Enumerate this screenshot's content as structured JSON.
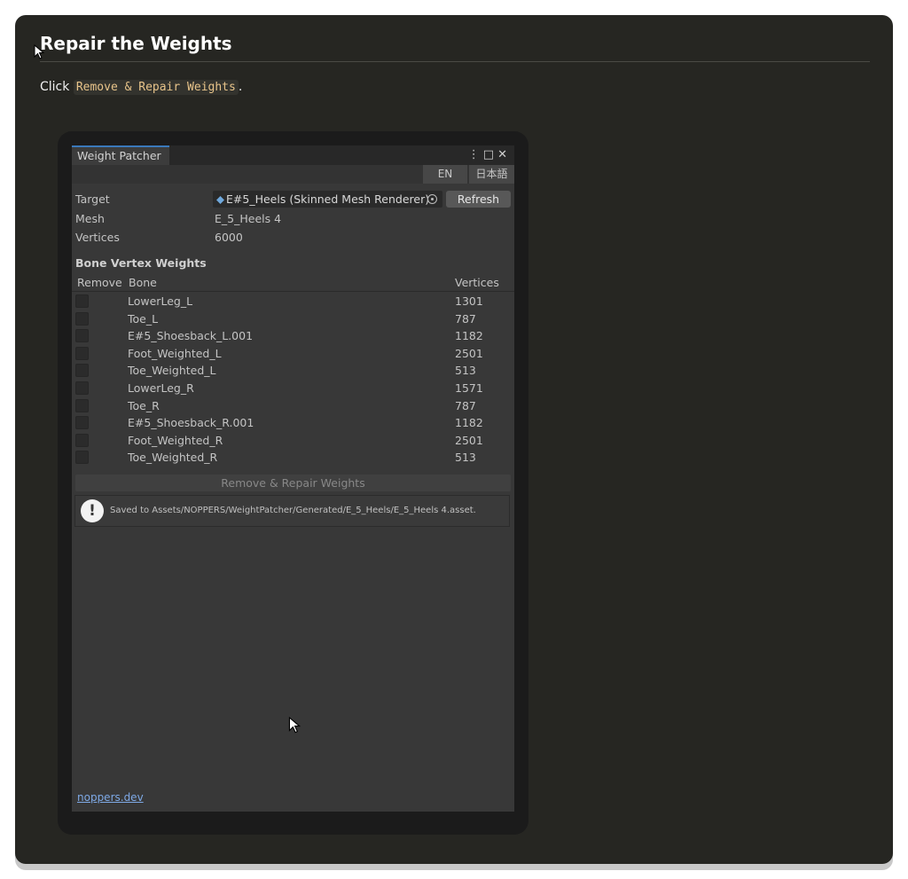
{
  "doc": {
    "title": "Repair the Weights",
    "instruction_prefix": "Click ",
    "instruction_code": "Remove & Repair Weights",
    "instruction_suffix": "."
  },
  "window": {
    "tab_label": "Weight Patcher",
    "controls": {
      "menu": "⋮",
      "maximize": "□",
      "close": "✕"
    },
    "lang_en": "EN",
    "lang_ja": "日本語",
    "target_label": "Target",
    "target_value": "E#5_Heels (Skinned Mesh Renderer)",
    "refresh_label": "Refresh",
    "mesh_label": "Mesh",
    "mesh_value": "E_5_Heels 4",
    "vertices_label": "Vertices",
    "vertices_value": "6000",
    "section_title": "Bone Vertex Weights",
    "columns": {
      "remove": "Remove",
      "bone": "Bone",
      "vertices": "Vertices"
    },
    "bones": [
      {
        "name": "LowerLeg_L",
        "vertices": "1301",
        "checked": false
      },
      {
        "name": "Toe_L",
        "vertices": "787",
        "checked": false
      },
      {
        "name": "E#5_Shoesback_L.001",
        "vertices": "1182",
        "checked": false
      },
      {
        "name": "Foot_Weighted_L",
        "vertices": "2501",
        "checked": false
      },
      {
        "name": "Toe_Weighted_L",
        "vertices": "513",
        "checked": false
      },
      {
        "name": "LowerLeg_R",
        "vertices": "1571",
        "checked": false
      },
      {
        "name": "Toe_R",
        "vertices": "787",
        "checked": false
      },
      {
        "name": "E#5_Shoesback_R.001",
        "vertices": "1182",
        "checked": false
      },
      {
        "name": "Foot_Weighted_R",
        "vertices": "2501",
        "checked": false
      },
      {
        "name": "Toe_Weighted_R",
        "vertices": "513",
        "checked": false
      }
    ],
    "repair_button": "Remove & Repair Weights",
    "help_message": "Saved to Assets/NOPPERS/WeightPatcher/Generated/E_5_Heels/E_5_Heels 4.asset.",
    "footer_link": "noppers.dev"
  },
  "colors": {
    "page_bg": "#262622",
    "window_bg": "#383838",
    "tab_accent": "#3a79bb",
    "code_text": "#e8c48a",
    "link": "#7ea9e6"
  },
  "icons": [
    "mouse-cursor-icon",
    "menu-dots-icon",
    "maximize-icon",
    "close-icon",
    "mesh-renderer-icon",
    "object-picker-icon",
    "info-icon"
  ]
}
